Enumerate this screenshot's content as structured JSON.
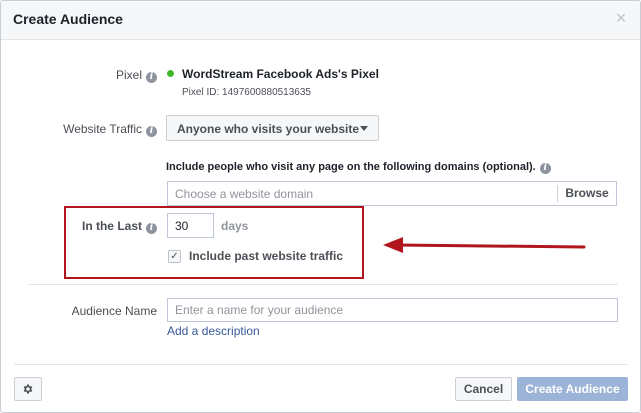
{
  "dialog": {
    "title": "Create Audience",
    "close_symbol": "×"
  },
  "pixel": {
    "label": "Pixel",
    "name": "WordStream Facebook Ads's Pixel",
    "id_text": "Pixel ID: 1497600880513635",
    "status_color": "#42b72a"
  },
  "website_traffic": {
    "label": "Website Traffic",
    "selected": "Anyone who visits your website"
  },
  "domains": {
    "label": "Include people who visit any page on the following domains (optional).",
    "placeholder": "Choose a website domain",
    "browse_label": "Browse"
  },
  "in_the_last": {
    "label": "In the Last",
    "value": "30",
    "unit": "days"
  },
  "past_traffic": {
    "label": "Include past website traffic",
    "checked": true,
    "check_symbol": "✓"
  },
  "audience_name": {
    "label": "Audience Name",
    "placeholder": "Enter a name for your audience",
    "add_description": "Add a description"
  },
  "footer": {
    "cancel_label": "Cancel",
    "create_label": "Create Audience"
  },
  "info_symbol": "i",
  "colors": {
    "annotation_red": "#b0161b",
    "link_blue": "#365899",
    "primary_disabled": "#9cb4d8"
  }
}
